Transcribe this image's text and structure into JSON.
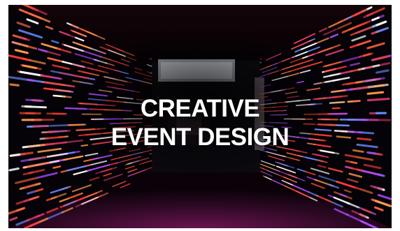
{
  "hero": {
    "title_line_1": "CREATIVE",
    "title_line_2": "EVENT DESIGN"
  },
  "colors": {
    "title_text": "#ffffff",
    "led_primary": "#e8402a",
    "led_accent_blue": "#6a8cff",
    "led_accent_violet": "#b04cff",
    "corridor_floor": "#3a0a2e",
    "backdrop": "#050208"
  },
  "icons": []
}
